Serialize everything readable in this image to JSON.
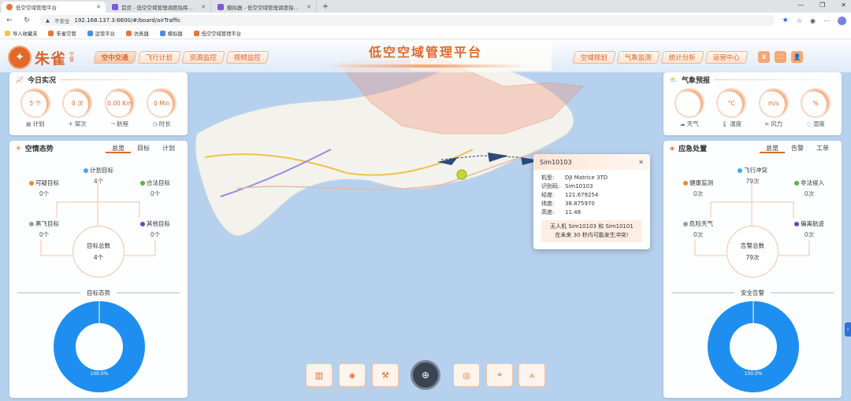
{
  "browser": {
    "tabs": [
      {
        "title": "低空空域管理平台",
        "active": true
      },
      {
        "title": "首页 - 低空空域管理调度指挥平台",
        "active": false
      },
      {
        "title": "模拟器 - 低空空域管理调度指挥平",
        "active": false
      }
    ],
    "address": {
      "security": "不安全",
      "url": "192.168.137.3:6600/#/board/airTraffic"
    },
    "bookmarks": [
      "导入收藏夹",
      "朱雀空管",
      "运营平台",
      "仿真器",
      "模拟器",
      "低空空域管理平台"
    ]
  },
  "header": {
    "logo_text": "朱雀",
    "logo_sub": "空管",
    "title": "低空空域管理平台",
    "nav_left": [
      "空中交通",
      "飞行计划",
      "资源监控",
      "视频监控"
    ],
    "nav_right": [
      "空域规划",
      "气象监测",
      "统计分析",
      "运营中心"
    ],
    "active_nav": "空中交通"
  },
  "today": {
    "title": "今日实况",
    "metrics": [
      {
        "value": "5 个",
        "label": "计划",
        "icon": "calendar-icon"
      },
      {
        "value": "0 次",
        "label": "架次",
        "icon": "plane-icon"
      },
      {
        "value": "0.00 Km",
        "label": "航程",
        "icon": "route-icon"
      },
      {
        "value": "0 Min",
        "label": "时长",
        "icon": "clock-icon"
      }
    ]
  },
  "situation": {
    "title": "空情态势",
    "tabs": [
      "总览",
      "目标",
      "计划"
    ],
    "nodes": {
      "plan": {
        "label": "计划目标",
        "value": "4个",
        "color": "#3fa9e8"
      },
      "suspicious": {
        "label": "可疑目标",
        "value": "0个",
        "color": "#f08a2c"
      },
      "legal": {
        "label": "合法目标",
        "value": "0个",
        "color": "#52b83a"
      },
      "black": {
        "label": "黑飞目标",
        "value": "0个",
        "color": "#9aa0a6"
      },
      "other": {
        "label": "其他目标",
        "value": "0个",
        "color": "#7a3fc8"
      }
    },
    "total_label": "目标总数",
    "total_value": "4个",
    "section_label": "目标态势",
    "donut_label": "100.0%",
    "donut_pct": 100
  },
  "weather": {
    "title": "气象预报",
    "metrics": [
      {
        "unit": "",
        "label": "天气",
        "icon": "cloud-icon"
      },
      {
        "unit": "°C",
        "label": "温度",
        "icon": "thermometer-icon"
      },
      {
        "unit": "m/s",
        "label": "风力",
        "icon": "wind-icon"
      },
      {
        "unit": "%",
        "label": "湿度",
        "icon": "droplet-icon"
      }
    ]
  },
  "emergency": {
    "title": "应急处置",
    "tabs": [
      "总览",
      "告警",
      "工单"
    ],
    "nodes": {
      "conflict": {
        "label": "飞行冲突",
        "value": "79次",
        "color": "#3fa9e8"
      },
      "health": {
        "label": "健康监测",
        "value": "0次",
        "color": "#f08a2c"
      },
      "intrusion": {
        "label": "非法侵入",
        "value": "0次",
        "color": "#52b83a"
      },
      "danger": {
        "label": "危险天气",
        "value": "0次",
        "color": "#9aa0a6"
      },
      "deviation": {
        "label": "偏离航迹",
        "value": "0次",
        "color": "#7a3fc8"
      }
    },
    "total_label": "告警总数",
    "total_value": "79次",
    "section_label": "安全告警",
    "donut_label": "100.0%",
    "donut_pct": 100
  },
  "popup": {
    "title": "Sim10103",
    "rows": [
      {
        "k": "机型:",
        "v": "DJI Matrice 3TD"
      },
      {
        "k": "识别码:",
        "v": "Sim10103"
      },
      {
        "k": "经度:",
        "v": "121.679254"
      },
      {
        "k": "纬度:",
        "v": "38.875970"
      },
      {
        "k": "高度:",
        "v": "11.48"
      }
    ],
    "alert_line1": "无人机 Sim10103 和 Sim10101",
    "alert_line2": "在未来 30 秒内可能发生冲突!"
  },
  "colors": {
    "accent": "#e06a2a",
    "donut": "#1e8ff0"
  }
}
